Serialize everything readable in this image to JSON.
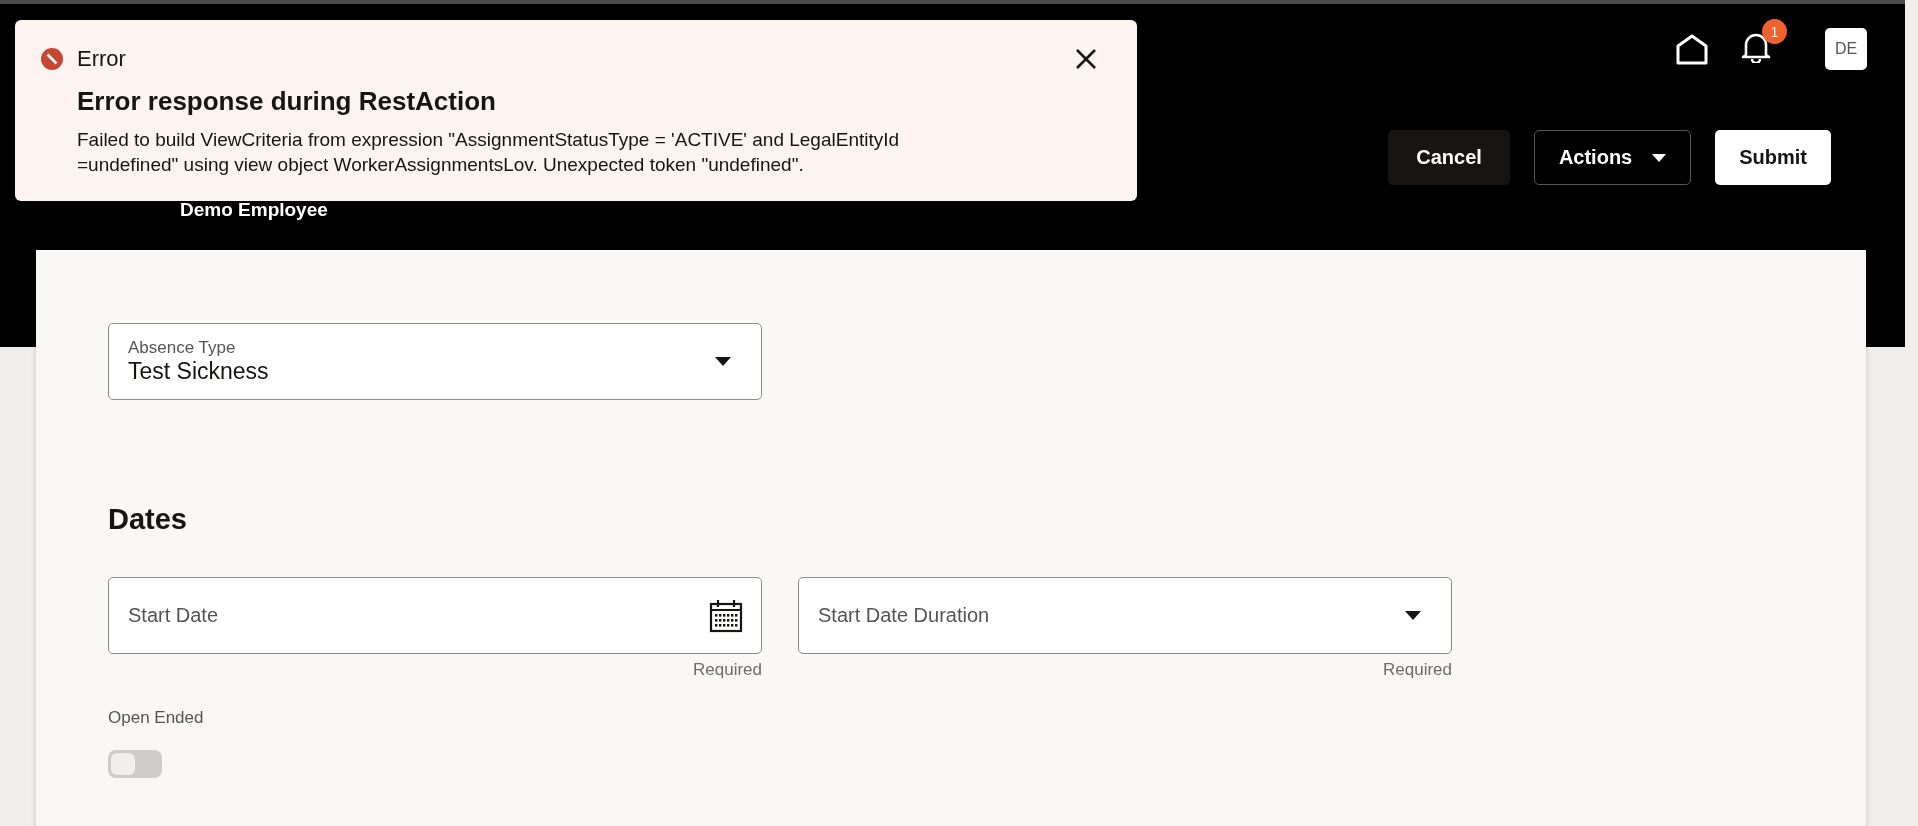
{
  "error_banner": {
    "label": "Error",
    "title": "Error response during RestAction",
    "message": "Failed to build ViewCriteria from expression \"AssignmentStatusType = 'ACTIVE' and LegalEntityId =undefined\" using view object WorkerAssignmentsLov. Unexpected token \"undefined\"."
  },
  "header": {
    "subtitle": "Demo Employee",
    "notification_count": "1",
    "avatar": "DE",
    "buttons": [
      {
        "label": "Cancel",
        "kind": "secondary"
      },
      {
        "label": "Actions",
        "kind": "menu"
      },
      {
        "label": "Submit",
        "kind": "primary"
      }
    ]
  },
  "form": {
    "absence_type": {
      "label": "Absence Type",
      "value": "Test Sickness"
    },
    "dates": {
      "heading": "Dates",
      "fields": [
        {
          "kind": "date",
          "placeholder": "Start Date",
          "help": "Required"
        },
        {
          "kind": "select",
          "placeholder": "Start Date Duration",
          "help": "Required"
        }
      ]
    },
    "open_ended": {
      "label": "Open Ended",
      "on": false
    }
  }
}
